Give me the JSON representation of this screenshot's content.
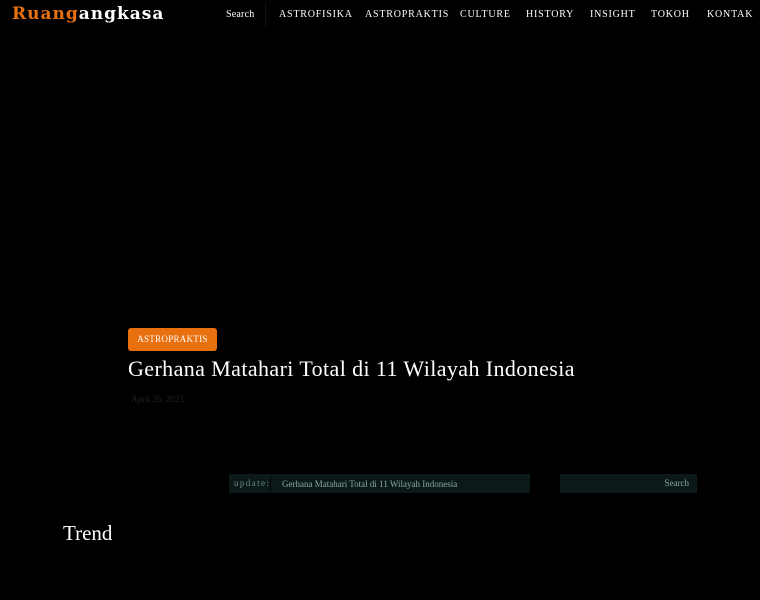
{
  "brand": {
    "logo_part1": "Ruang",
    "logo_part2": "angkasa",
    "accent_color": "#e8700f"
  },
  "nav": {
    "search_label": "Search",
    "items": [
      {
        "label": "ASTROFISIKA"
      },
      {
        "label": "ASTROPRAKTIS"
      },
      {
        "label": "CULTURE"
      },
      {
        "label": "HISTORY"
      },
      {
        "label": "INSIGHT"
      },
      {
        "label": "TOKOH"
      },
      {
        "label": "KONTAK"
      }
    ]
  },
  "hero": {
    "category": "ASTROPRAKTIS",
    "title": "Gerhana Matahari Total di 11 Wilayah Indonesia",
    "date": "April 26, 2023"
  },
  "ticker": {
    "label": "update:",
    "headline": "Gerhana Matahari Total di 11 Wilayah Indonesia"
  },
  "search": {
    "button_label": "Search",
    "placeholder": ""
  },
  "sections": {
    "trend_title": "Trend"
  }
}
